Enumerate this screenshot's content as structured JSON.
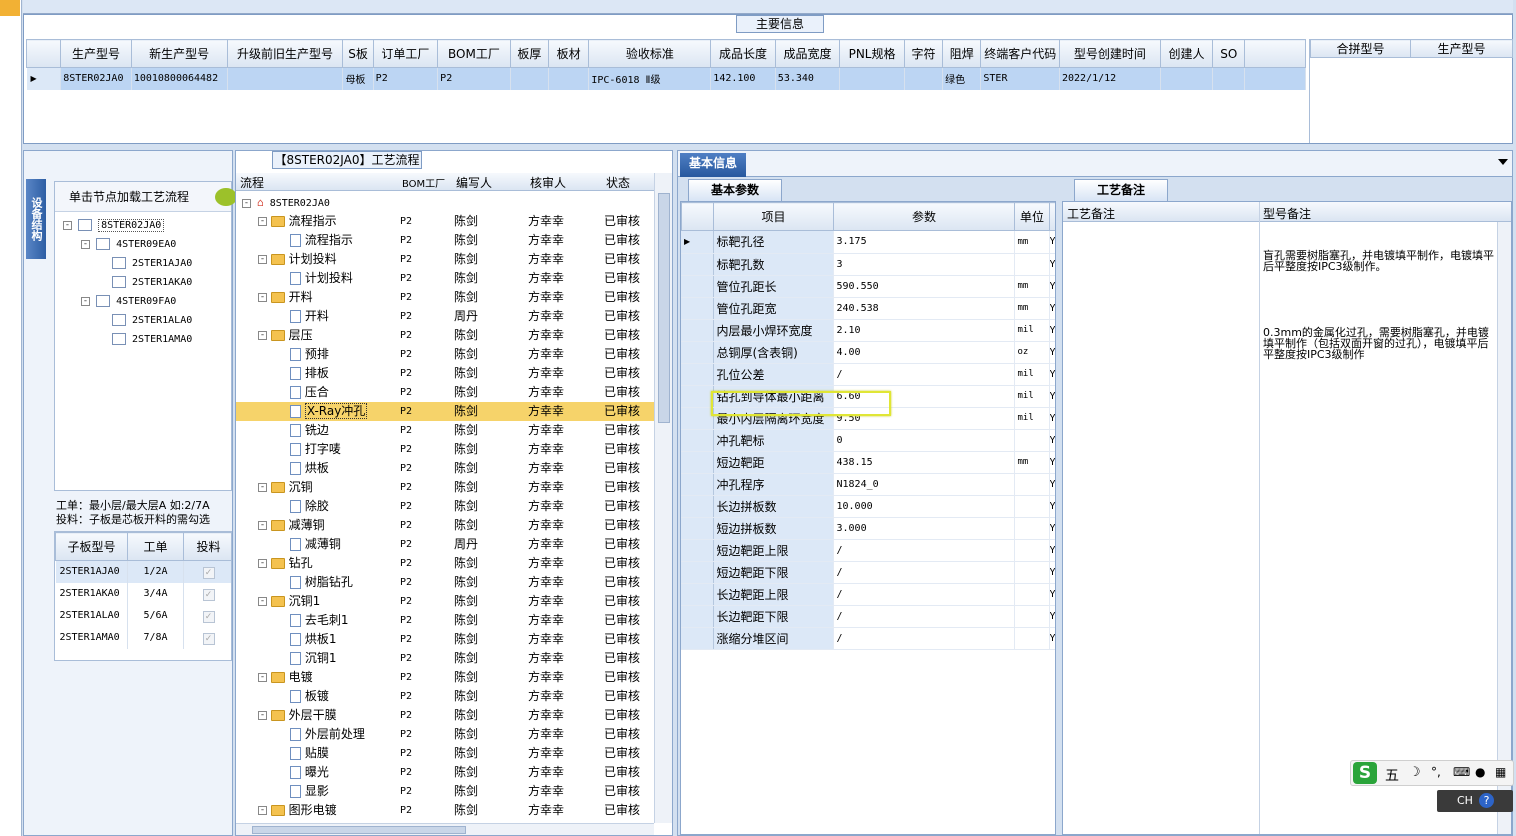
{
  "main_info": {
    "title": "主要信息",
    "columns": [
      "生产型号",
      "新生产型号",
      "升级前旧生产型号",
      "S板",
      "订单工厂",
      "BOM工厂",
      "板厚",
      "板材",
      "验收标准",
      "成品长度",
      "成品宽度",
      "PNL规格",
      "字符",
      "阻焊",
      "终端客户代码",
      "型号创建时间",
      "创建人",
      "SO"
    ],
    "row": [
      "8STER02JA0",
      "10010800064482",
      "",
      "母板",
      "P2",
      "P2",
      "",
      "",
      "IPC-6018 Ⅱ级",
      "142.100",
      "53.340",
      "",
      "",
      "绿色",
      "STER",
      "2022/1/12",
      "",
      ""
    ],
    "right_columns": [
      "合拼型号",
      "生产型号"
    ]
  },
  "left_panel": {
    "vtab": "设备结构",
    "hint": "单击节点加载工艺流程",
    "tree": [
      {
        "label": "8STER02JA0",
        "level": 0,
        "sign": "-"
      },
      {
        "label": "4STER09EA0",
        "level": 1,
        "sign": "-"
      },
      {
        "label": "2STER1AJA0",
        "level": 2,
        "sign": ""
      },
      {
        "label": "2STER1AKA0",
        "level": 2,
        "sign": ""
      },
      {
        "label": "4STER09FA0",
        "level": 1,
        "sign": "-"
      },
      {
        "label": "2STER1ALA0",
        "level": 2,
        "sign": ""
      },
      {
        "label": "2STER1AMA0",
        "level": 2,
        "sign": ""
      }
    ],
    "note1": "工单：最小层/最大层A 如:2/7A",
    "note2": "投料：子板是芯板开料的需勾选",
    "sub_columns": [
      "子板型号",
      "工单",
      "投料"
    ],
    "sub_rows": [
      [
        "2STER1AJA0",
        "1/2A"
      ],
      [
        "2STER1AKA0",
        "3/4A"
      ],
      [
        "2STER1ALA0",
        "5/6A"
      ],
      [
        "2STER1AMA0",
        "7/8A"
      ]
    ]
  },
  "flow": {
    "title": "【8STER02JA0】工艺流程",
    "columns": [
      "流程",
      "BOM工厂",
      "编写人",
      "核审人",
      "状态"
    ],
    "root": "8STER02JA0",
    "rows": [
      {
        "n": "流程指示",
        "f": 1,
        "w": "陈剑"
      },
      {
        "n": "流程指示",
        "f": 0,
        "w": "陈剑"
      },
      {
        "n": "计划投料",
        "f": 1,
        "w": "陈剑"
      },
      {
        "n": "计划投料",
        "f": 0,
        "w": "陈剑"
      },
      {
        "n": "开料",
        "f": 1,
        "w": "陈剑"
      },
      {
        "n": "开料",
        "f": 0,
        "w": "周丹"
      },
      {
        "n": "层压",
        "f": 1,
        "w": "陈剑"
      },
      {
        "n": "预排",
        "f": 0,
        "w": "陈剑"
      },
      {
        "n": "排板",
        "f": 0,
        "w": "陈剑"
      },
      {
        "n": "压合",
        "f": 0,
        "w": "陈剑"
      },
      {
        "n": "X-Ray冲孔",
        "f": 0,
        "w": "陈剑",
        "sel": 1
      },
      {
        "n": "铣边",
        "f": 0,
        "w": "陈剑"
      },
      {
        "n": "打字唛",
        "f": 0,
        "w": "陈剑"
      },
      {
        "n": "烘板",
        "f": 0,
        "w": "陈剑"
      },
      {
        "n": "沉铜",
        "f": 1,
        "w": "陈剑"
      },
      {
        "n": "除胶",
        "f": 0,
        "w": "陈剑"
      },
      {
        "n": "减薄铜",
        "f": 1,
        "w": "陈剑"
      },
      {
        "n": "减薄铜",
        "f": 0,
        "w": "周丹"
      },
      {
        "n": "钻孔",
        "f": 1,
        "w": "陈剑"
      },
      {
        "n": "树脂钻孔",
        "f": 0,
        "w": "陈剑"
      },
      {
        "n": "沉铜1",
        "f": 1,
        "w": "陈剑"
      },
      {
        "n": "去毛刺1",
        "f": 0,
        "w": "陈剑"
      },
      {
        "n": "烘板1",
        "f": 0,
        "w": "陈剑"
      },
      {
        "n": "沉铜1",
        "f": 0,
        "w": "陈剑"
      },
      {
        "n": "电镀",
        "f": 1,
        "w": "陈剑"
      },
      {
        "n": "板镀",
        "f": 0,
        "w": "陈剑"
      },
      {
        "n": "外层干膜",
        "f": 1,
        "w": "陈剑"
      },
      {
        "n": "外层前处理",
        "f": 0,
        "w": "陈剑"
      },
      {
        "n": "贴膜",
        "f": 0,
        "w": "陈剑"
      },
      {
        "n": "曝光",
        "f": 0,
        "w": "陈剑"
      },
      {
        "n": "显影",
        "f": 0,
        "w": "陈剑"
      },
      {
        "n": "图形电镀",
        "f": 1,
        "w": "陈剑"
      }
    ],
    "bom": "P2",
    "checker": "方幸幸",
    "status": "已审核"
  },
  "basic": {
    "tab": "基本信息",
    "subtab": "基本参数",
    "columns": [
      "项目",
      "参数",
      "单位"
    ],
    "rows": [
      [
        "标靶孔径",
        "3.175",
        "mm"
      ],
      [
        "标靶孔数",
        "3",
        ""
      ],
      [
        "管位孔距长",
        "590.550",
        "mm"
      ],
      [
        "管位孔距宽",
        "240.538",
        "mm"
      ],
      [
        "内层最小焊环宽度",
        "2.10",
        "mil"
      ],
      [
        "总铜厚(含表铜)",
        "4.00",
        "oz"
      ],
      [
        "孔位公差",
        "/",
        "mil"
      ],
      [
        "钻孔到导体最小距离",
        "6.60",
        "mil"
      ],
      [
        "最小内层隔离环宽度",
        "9.50",
        "mil"
      ],
      [
        "冲孔靶标",
        "0",
        ""
      ],
      [
        "短边靶距",
        "438.15",
        "mm"
      ],
      [
        "冲孔程序",
        "N1824_0",
        ""
      ],
      [
        "长边拼板数",
        "10.000",
        ""
      ],
      [
        "短边拼板数",
        "3.000",
        ""
      ],
      [
        "短边靶距上限",
        "/",
        ""
      ],
      [
        "短边靶距下限",
        "/",
        ""
      ],
      [
        "长边靶距上限",
        "/",
        ""
      ],
      [
        "长边靶距下限",
        "/",
        ""
      ],
      [
        "涨缩分堆区间",
        "/",
        ""
      ]
    ],
    "flag": "Y"
  },
  "remark": {
    "tab": "工艺备注",
    "columns": [
      "工艺备注",
      "型号备注"
    ],
    "text1": "盲孔需要树脂塞孔，并电镀填平制作，电镀填平后平整度按IPC3级制作。",
    "text2": "0.3mm的金属化过孔，需要树脂塞孔，并电镀填平制作（包括双面开窗的过孔），电镀填平后平整度按IPC3级制作"
  },
  "ime": {
    "logo": "S",
    "label": "五",
    "lang": "CH"
  }
}
